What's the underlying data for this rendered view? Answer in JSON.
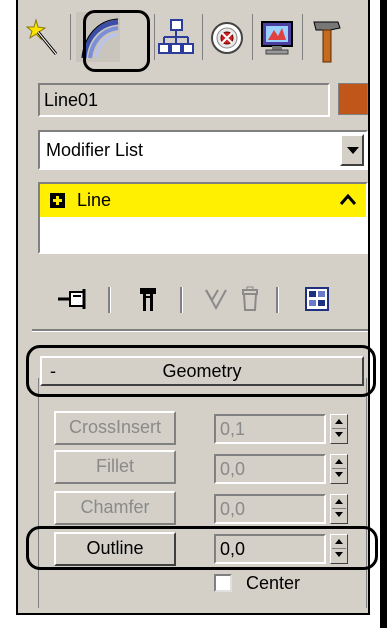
{
  "tabs": [
    {
      "name": "create",
      "icon": "create-wand-icon"
    },
    {
      "name": "modify",
      "icon": "modify-curve-icon",
      "active": true
    },
    {
      "name": "hierarchy",
      "icon": "hierarchy-icon"
    },
    {
      "name": "motion",
      "icon": "motion-icon"
    },
    {
      "name": "display",
      "icon": "display-monitor-icon"
    },
    {
      "name": "utilities",
      "icon": "utilities-hammer-icon"
    }
  ],
  "object": {
    "name": "Line01",
    "color": "#c0561a"
  },
  "modifier_list": {
    "selected": "Modifier List"
  },
  "stack": {
    "items": [
      {
        "label": "Line",
        "highlight_color": "#ffef00"
      }
    ]
  },
  "stack_toolbar": {
    "icons": [
      "pin-stack-icon",
      "show-end-result-icon",
      "make-unique-icon",
      "remove-modifier-icon",
      "configure-modifier-sets-icon"
    ]
  },
  "geometry": {
    "collapse_symbol": "-",
    "title": "Geometry",
    "commands": [
      {
        "label": "CrossInsert",
        "value": "0,1",
        "enabled": false
      },
      {
        "label": "Fillet",
        "value": "0,0",
        "enabled": false
      },
      {
        "label": "Chamfer",
        "value": "0,0",
        "enabled": false
      },
      {
        "label": "Outline",
        "value": "0,0",
        "enabled": true
      }
    ],
    "center_label": "Center",
    "center_checked": false
  }
}
